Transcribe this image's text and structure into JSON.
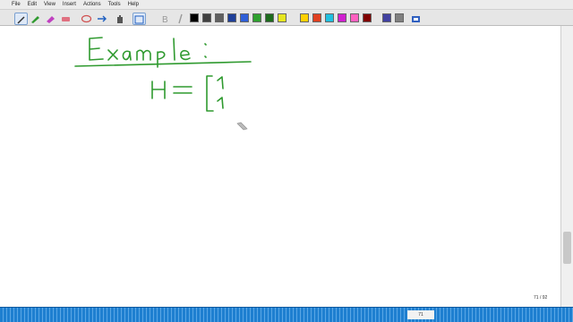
{
  "menubar": {
    "items": [
      "File",
      "Edit",
      "View",
      "Insert",
      "Actions",
      "Tools",
      "Help"
    ]
  },
  "toolbar": {
    "tools": [
      "select-icon",
      "pen-icon",
      "highlighter-icon",
      "eraser-icon",
      "lasso-icon",
      "insert-space-icon",
      "hand-icon",
      "zoom-icon",
      "bold-icon",
      "italic-icon"
    ],
    "palette": [
      "#000000",
      "#404040",
      "#606060",
      "#1f3f99",
      "#2e5fd8",
      "#2ea02e",
      "#1d6b1d",
      "#e6e620",
      "#ffd000",
      "#e04020",
      "#20c0e0",
      "#d020d0",
      "#ff60c0",
      "#800000",
      "#4040a0",
      "#808080"
    ]
  },
  "canvas": {
    "heading": "Example :",
    "lhs": "H",
    "equals": "=",
    "matrix_entries": [
      "1",
      "1"
    ],
    "ink_color": "#2f9a2f",
    "cursor": "pen-cursor-icon"
  },
  "status": {
    "page_label": "71",
    "page_counter": "71 / 92"
  }
}
